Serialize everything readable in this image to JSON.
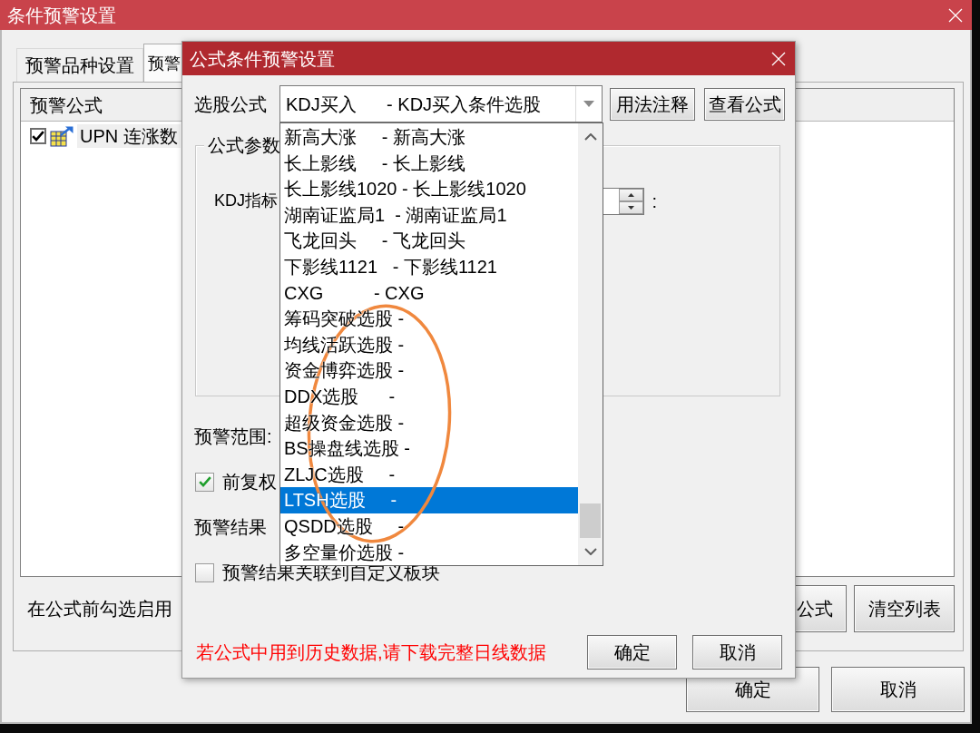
{
  "window": {
    "title": "条件预警设置"
  },
  "tabs": [
    {
      "label": "预警品种设置",
      "selected": false
    },
    {
      "label": "预警",
      "selected": true
    }
  ],
  "formula_list": {
    "header": "预警公式",
    "rows": [
      {
        "label": "UPN 连涨数",
        "checked": true
      }
    ]
  },
  "hint": "在公式前勾选启用",
  "list_buttons": [
    "公式",
    "清空列表"
  ],
  "buttons": [
    "确定",
    "取消"
  ],
  "dialog": {
    "title": "公式条件预警设置",
    "formula_label": "选股公式",
    "formula_select": {
      "value": "KDJ买入      - KDJ买入条件选股",
      "expanded": true,
      "options": [
        {
          "text": "新高大涨     - 新高大涨",
          "selected": false
        },
        {
          "text": "长上影线     - 长上影线",
          "selected": false
        },
        {
          "text": "长上影线1020 - 长上影线1020",
          "selected": false
        },
        {
          "text": "湖南证监局1  - 湖南证监局1",
          "selected": false
        },
        {
          "text": "飞龙回头     - 飞龙回头",
          "selected": false
        },
        {
          "text": "下影线1121   - 下影线1121",
          "selected": false
        },
        {
          "text": "CXG          - CXG",
          "selected": false
        },
        {
          "text": "筹码突破选股 -",
          "selected": false
        },
        {
          "text": "均线活跃选股 -",
          "selected": false
        },
        {
          "text": "资金博弈选股 -",
          "selected": false
        },
        {
          "text": "DDX选股      -",
          "selected": false
        },
        {
          "text": "超级资金选股 -",
          "selected": false
        },
        {
          "text": "BS操盘线选股 -",
          "selected": false
        },
        {
          "text": "ZLJC选股     -",
          "selected": false
        },
        {
          "text": "LTSH选股     -",
          "selected": true
        },
        {
          "text": "QSDD选股     -",
          "selected": false
        },
        {
          "text": "多空量价选股 -",
          "selected": false
        }
      ]
    },
    "formula_buttons": [
      "用法注释",
      "查看公式"
    ],
    "params": {
      "title": "公式参数",
      "rows": [
        {
          "label": "KDJ指标",
          "suffix": ":"
        }
      ]
    },
    "settings": [
      {
        "kind": "label",
        "text": "预警范围:"
      },
      {
        "kind": "checkbox",
        "label": "前复权",
        "checked": true
      },
      {
        "kind": "label",
        "text": "预警结果"
      },
      {
        "kind": "checkbox",
        "label": "预警结果关联到自定义板块",
        "checked": false
      }
    ],
    "note": "若公式中用到历史数据,请下载完整日线数据",
    "buttons": [
      "确定",
      "取消"
    ]
  }
}
